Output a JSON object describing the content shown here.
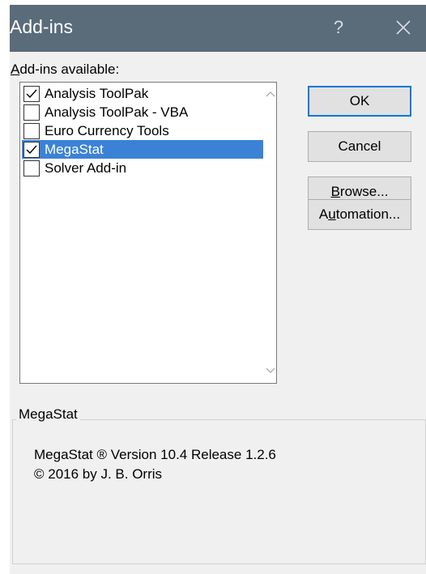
{
  "window": {
    "title": "Add-ins",
    "help_glyph": "?"
  },
  "list": {
    "label_accel": "A",
    "label_rest": "dd-ins available:",
    "items": [
      {
        "label": "Analysis ToolPak",
        "checked": true,
        "selected": false
      },
      {
        "label": "Analysis ToolPak - VBA",
        "checked": false,
        "selected": false
      },
      {
        "label": "Euro Currency Tools",
        "checked": false,
        "selected": false
      },
      {
        "label": "MegaStat",
        "checked": true,
        "selected": true
      },
      {
        "label": "Solver Add-in",
        "checked": false,
        "selected": false
      }
    ]
  },
  "buttons": {
    "ok": "OK",
    "cancel": "Cancel",
    "browse_accel": "B",
    "browse_rest": "rowse...",
    "automation_pre": "A",
    "automation_accel": "u",
    "automation_rest": "tomation..."
  },
  "description": {
    "title": "MegaStat",
    "line1": "MegaStat ®  Version 10.4 Release 1.2.6",
    "line2": "© 2016 by J. B. Orris"
  },
  "colors": {
    "titlebar": "#5a6b7a",
    "selection": "#3b82d6",
    "default_border": "#0078d7"
  }
}
